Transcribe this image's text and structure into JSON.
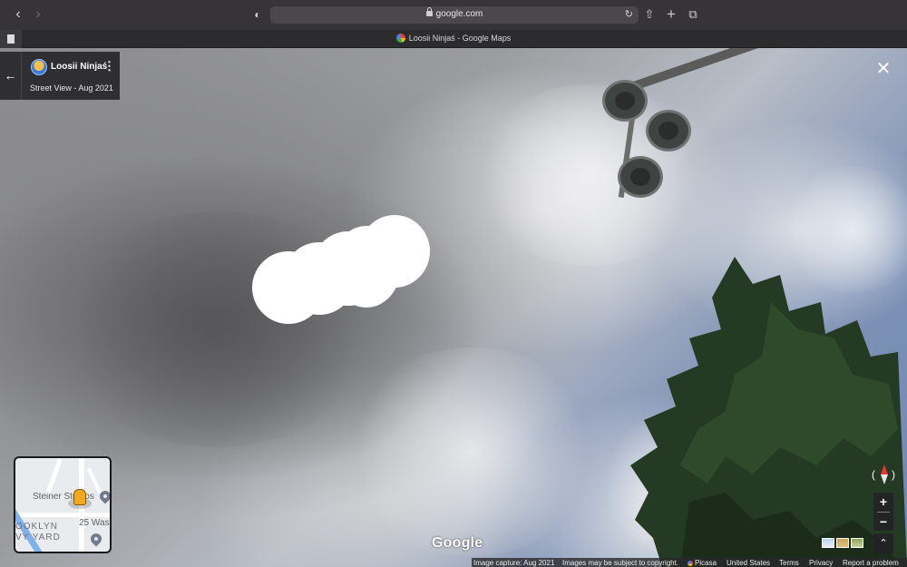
{
  "browser": {
    "address": "google.com",
    "tab_title": "Loosii Ninjaś - Google Maps",
    "icons": [
      "back-icon",
      "forward-icon",
      "shield-icon",
      "lock-icon",
      "reload-icon",
      "share-icon",
      "new-tab-icon",
      "tabs-overview-icon",
      "document-icon",
      "google-favicon"
    ]
  },
  "info_card": {
    "name": "Loosii Ninjaś",
    "subtitle": "Street View - Aug 2021",
    "back_glyph": "←",
    "menu_glyph": "⋮"
  },
  "close_glyph": "✕",
  "minimap": {
    "labels": {
      "studios": "Steiner Studios",
      "address": "25 Was",
      "district_1": "OOKLYN",
      "district_2": "VY YARD"
    }
  },
  "controls": {
    "zoom_in": "+",
    "zoom_out": "−",
    "expand": "⌃"
  },
  "google_logo": "Google",
  "footer": {
    "capture": "Image capture: Aug 2021",
    "copyright": "Images may be subject to copyright.",
    "picasa": "Picasa",
    "country": "United States",
    "terms": "Terms",
    "privacy": "Privacy",
    "report": "Report a problem"
  },
  "colors": {
    "compass_north": "#e53935",
    "map_water": "#7fb1ea",
    "peg": "#f4a81d"
  }
}
